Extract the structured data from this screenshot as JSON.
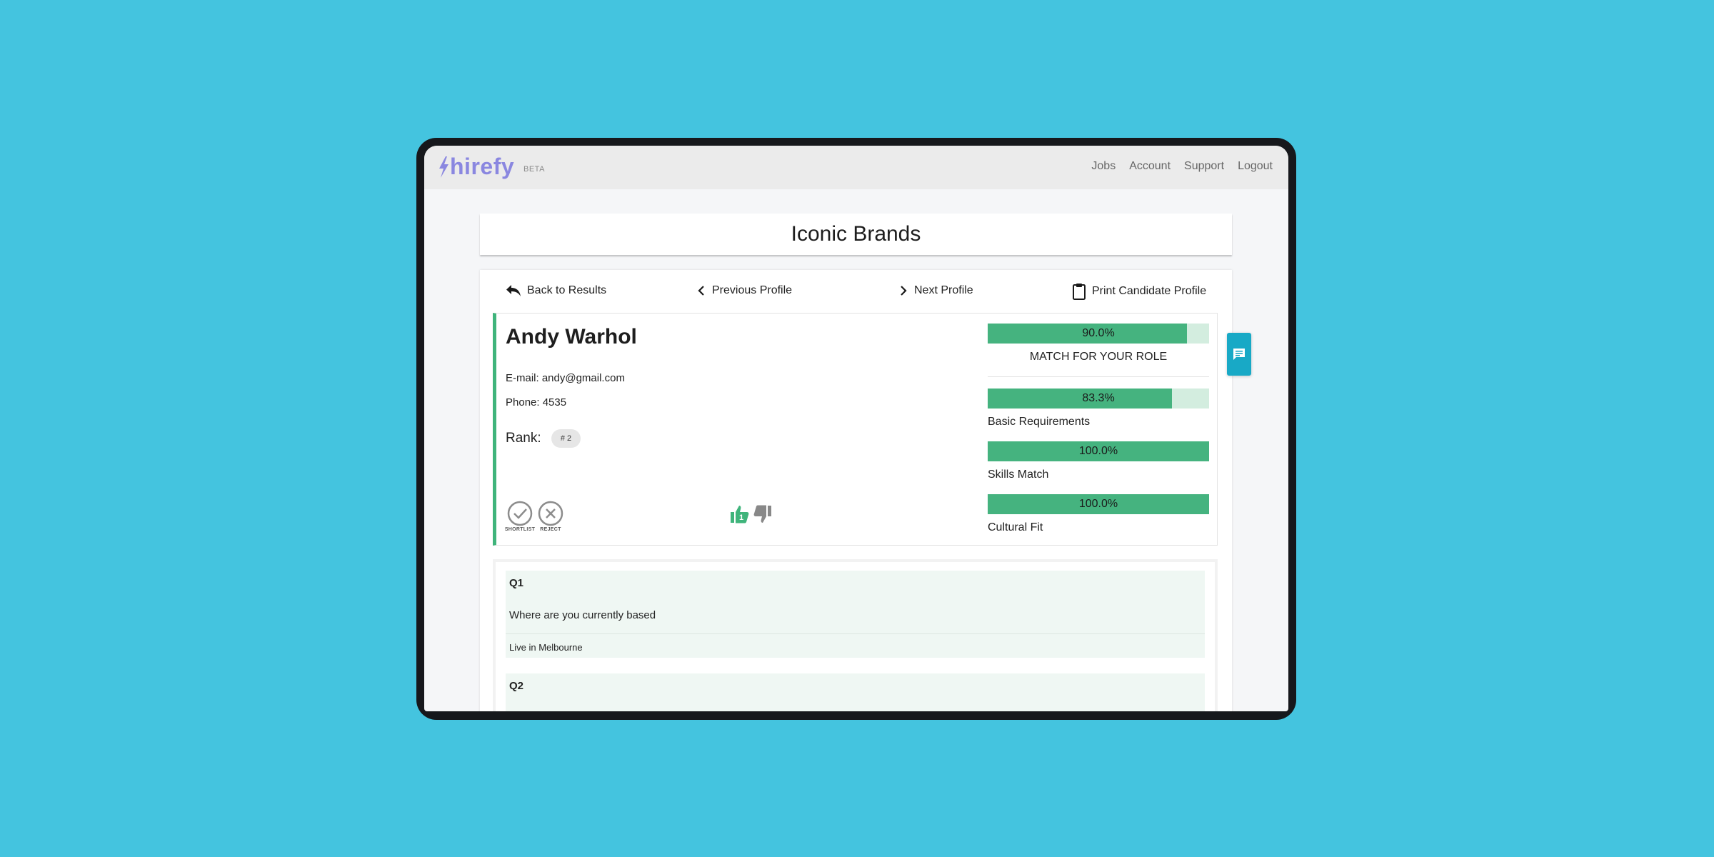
{
  "brand": {
    "name": "hirefy",
    "badge": "BETA",
    "color": "#8a87e0"
  },
  "nav": {
    "jobs": "Jobs",
    "account": "Account",
    "support": "Support",
    "logout": "Logout"
  },
  "page": {
    "title": "Iconic Brands"
  },
  "actions": {
    "back": "Back to Results",
    "previous": "Previous Profile",
    "next": "Next Profile",
    "print": "Print Candidate Profile"
  },
  "candidate": {
    "name": "Andy Warhol",
    "email_line": "E-mail: andy@gmail.com",
    "phone_line": "Phone: 4535",
    "rank_label": "Rank:",
    "rank_badge": "# 2",
    "shortlist_label": "SHORTLIST",
    "reject_label": "REJECT",
    "upvote_count": "1"
  },
  "scores": {
    "overall": {
      "percent": 90.0,
      "text": "90.0%",
      "label": "MATCH FOR YOUR ROLE"
    },
    "items": [
      {
        "percent": 83.3,
        "text": "83.3%",
        "label": "Basic Requirements"
      },
      {
        "percent": 100.0,
        "text": "100.0%",
        "label": "Skills Match"
      },
      {
        "percent": 100.0,
        "text": "100.0%",
        "label": "Cultural Fit"
      }
    ]
  },
  "questions": [
    {
      "number": "Q1",
      "question": "Where are you currently based",
      "answer": "Live in Melbourne"
    },
    {
      "number": "Q2"
    }
  ],
  "colors": {
    "accent_green": "#45b37f",
    "bar_track": "#d3eddf",
    "chat_tab": "#18a9c6",
    "background": "#44c4df"
  },
  "icons": [
    "bolt-logo-icon",
    "reply-arrow-icon",
    "chevron-left-icon",
    "chevron-right-icon",
    "clipboard-icon",
    "check-circle-icon",
    "x-circle-icon",
    "thumbs-up-icon",
    "thumbs-down-icon",
    "chat-icon"
  ]
}
